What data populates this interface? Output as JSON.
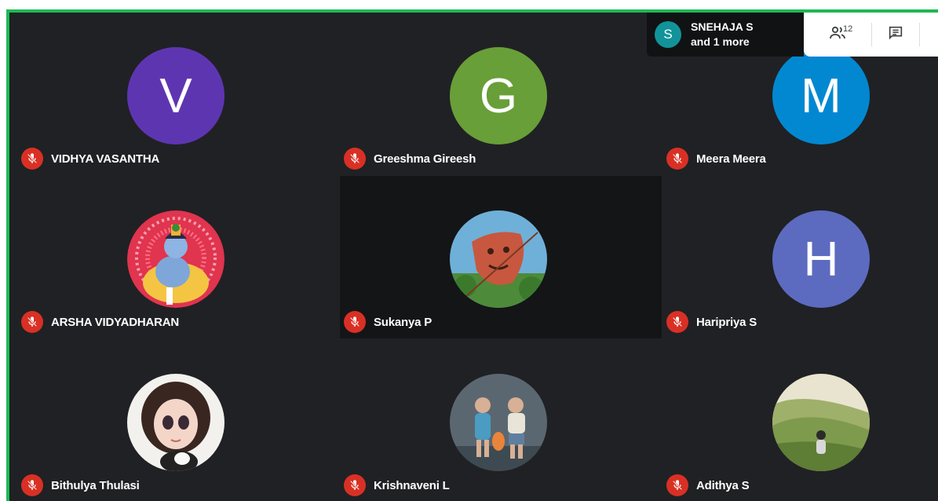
{
  "speaker": {
    "initial": "S",
    "name": "SNEHAJA S",
    "more": "and 1 more"
  },
  "toolbar": {
    "people_count": "12",
    "people_icon": "people-icon",
    "chat_icon": "chat-icon"
  },
  "participants": [
    {
      "name": "VIDHYA VASANTHA",
      "initial": "V",
      "color": "#5e35b1"
    },
    {
      "name": "Greeshma Gireesh",
      "initial": "G",
      "color": "#689f38"
    },
    {
      "name": "Meera Meera",
      "initial": "M",
      "color": "#0288d1"
    },
    {
      "name": "ARSHA VIDYADHARAN",
      "photo": "krishna"
    },
    {
      "name": "Sukanya P",
      "photo": "leaf-face",
      "speaking": true
    },
    {
      "name": "Haripriya S",
      "initial": "H",
      "color": "#5c6bc0"
    },
    {
      "name": "Bithulya Thulasi",
      "photo": "doll"
    },
    {
      "name": "Krishnaveni L",
      "photo": "children"
    },
    {
      "name": "Adithya S",
      "photo": "meadow"
    }
  ],
  "colors": {
    "border": "#1db954",
    "mute": "#d93025",
    "background": "#202124"
  }
}
